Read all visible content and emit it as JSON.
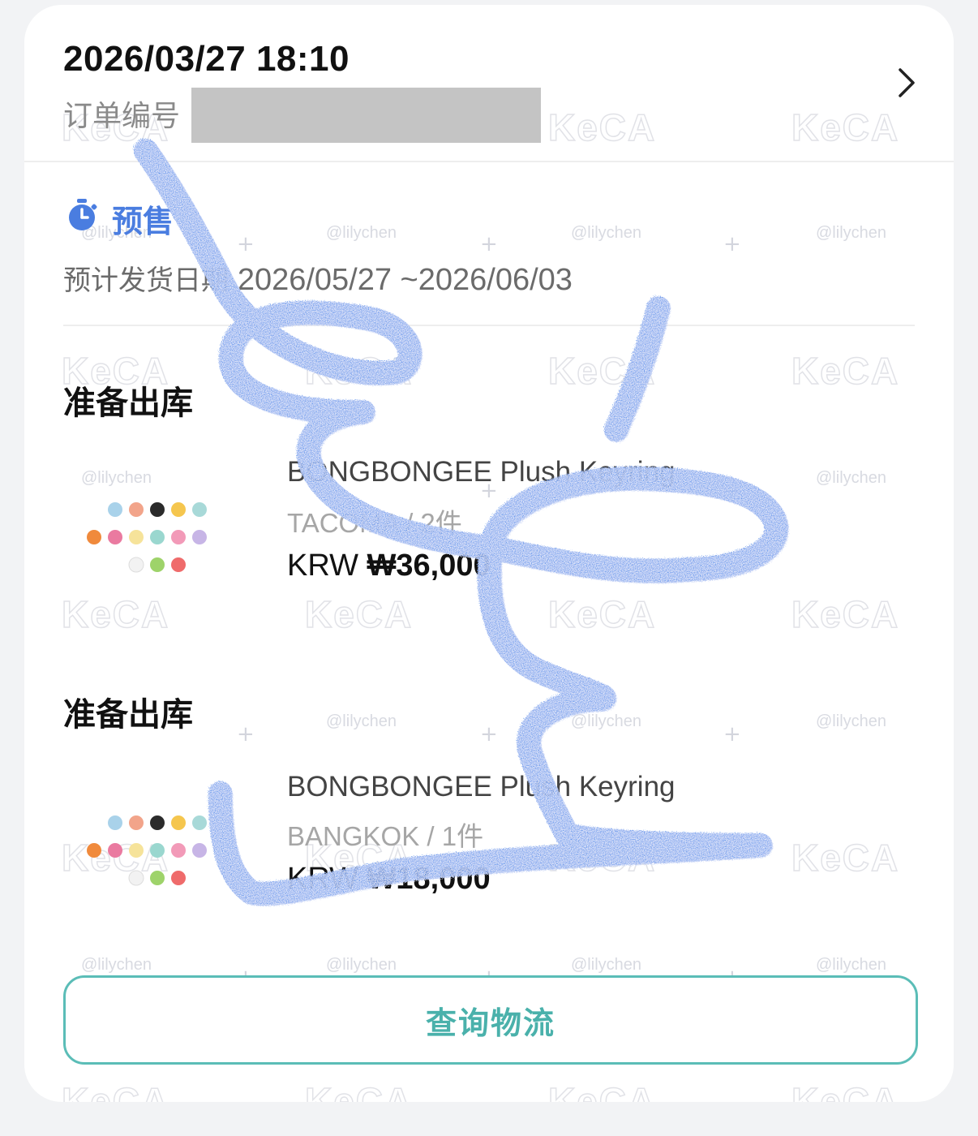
{
  "order": {
    "datetime": "2026/03/27 18:10",
    "number_label": "订单编号"
  },
  "presale": {
    "label": "预售",
    "ship_date_label": "预计发货日期",
    "ship_date_range": "2026/05/27 ~2026/06/03"
  },
  "items": [
    {
      "status": "准备出库",
      "name": "BONGBONGEE Plush Keyring",
      "variant": "TACOMA / 2件",
      "currency": "KRW",
      "price": "₩36,000"
    },
    {
      "status": "准备出库",
      "name": "BONGBONGEE Plush Keyring",
      "variant": "BANGKOK / 1件",
      "currency": "KRW",
      "price": "₩18,000"
    }
  ],
  "actions": {
    "track_label": "查询物流"
  },
  "colors": {
    "accent_teal": "#5bbdb7",
    "presale_blue": "#4a7de0",
    "scribble_blue": "#3f86ea"
  }
}
